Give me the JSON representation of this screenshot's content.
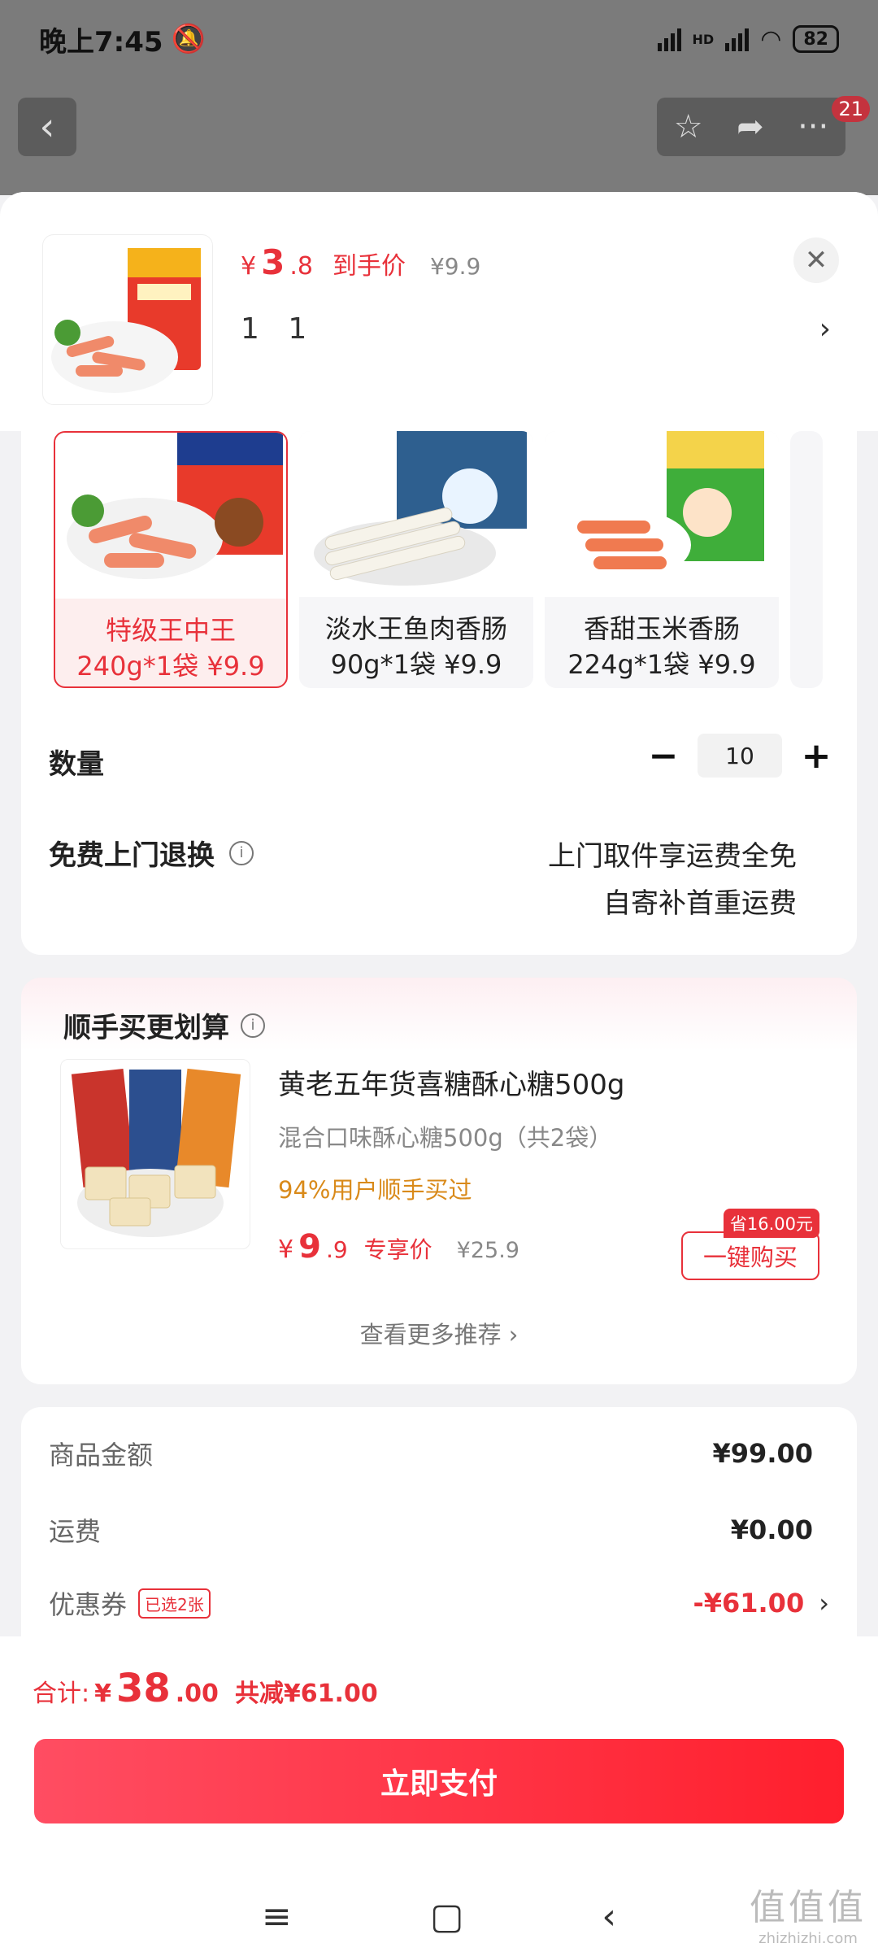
{
  "status_bar": {
    "time": "晚上7:45",
    "network": "HD",
    "battery": "82"
  },
  "background": {
    "badge_count": "21"
  },
  "header": {
    "price_yen": "¥",
    "price_int": "3",
    "price_dec": ".8",
    "price_tag": "到手价",
    "original_price": "¥9.9",
    "selected_text": "1 1"
  },
  "variants": [
    {
      "name": "特级王中王",
      "spec": "240g*1袋 ¥9.9",
      "selected": true
    },
    {
      "name": "淡水王鱼肉香肠",
      "spec": "90g*1袋 ¥9.9",
      "selected": false
    },
    {
      "name": "香甜玉米香肠",
      "spec": "224g*1袋 ¥9.9",
      "selected": false
    }
  ],
  "quantity": {
    "label": "数量",
    "value": "10"
  },
  "return_service": {
    "label": "免费上门退换",
    "line1": "上门取件享运费全免",
    "line2": "自寄补首重运费"
  },
  "recommend": {
    "title": "顺手买更划算",
    "item_name": "黄老五年货喜糖酥心糖500g",
    "item_spec": "混合口味酥心糖500g（共2袋）",
    "bought": "94%用户顺手买过",
    "price_yen": "¥",
    "price_int": "9",
    "price_dec": ".9",
    "price_tag": "专享价",
    "original_price": "¥25.9",
    "save_badge": "省16.00元",
    "buy_button": "一键购买",
    "more": "查看更多推荐 ›"
  },
  "summary": {
    "goods_label": "商品金额",
    "goods_value": "¥99.00",
    "shipping_label": "运费",
    "shipping_value": "¥0.00",
    "coupon_label": "优惠券",
    "coupon_tag": "已选2张",
    "coupon_value": "-¥61.00"
  },
  "footer": {
    "total_label": "合计:",
    "total_yen": "¥",
    "total_int": "38",
    "total_dec": ".00",
    "discount": "共减¥61.00",
    "pay_button": "立即支付"
  },
  "watermark": {
    "logo": "值值值",
    "url": "zhizhizhi.com"
  },
  "colors": {
    "accent": "#e8313a",
    "price_orange": "#d98a1a"
  }
}
